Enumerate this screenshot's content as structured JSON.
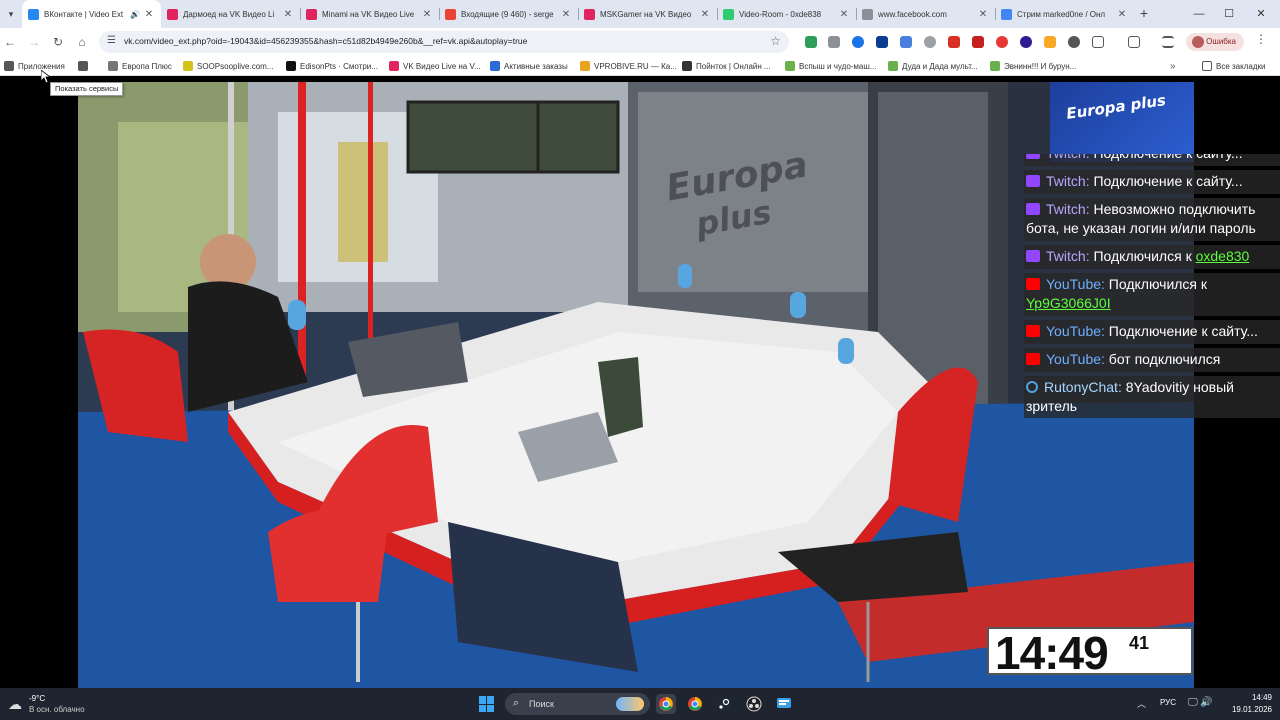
{
  "browser": {
    "tabs": [
      {
        "title": "ВКонтакте | Video Ext",
        "favicon": "vk-icon",
        "color": "#2787f5",
        "active": true,
        "audio": true
      },
      {
        "title": "Дармоед на VK Видео Li",
        "favicon": "vk-video-icon",
        "color": "#e0245e"
      },
      {
        "title": "Minami на VK Видео Live",
        "favicon": "vk-video-icon",
        "color": "#e0245e"
      },
      {
        "title": "Входящие (9 460) - serge",
        "favicon": "gmail-icon",
        "color": "#ea4335"
      },
      {
        "title": "MSKGamer на VK Видео",
        "favicon": "vk-video-icon",
        "color": "#e0245e"
      },
      {
        "title": "Video-Room - 0xde838",
        "favicon": "video-room-icon",
        "color": "#2ecc71"
      },
      {
        "title": "www.facebook.com",
        "favicon": "globe-icon",
        "color": "#8a8f98"
      },
      {
        "title": "Стрим marked0ne / Онл",
        "favicon": "google-icon",
        "color": "#4285f4"
      }
    ],
    "url": "vk.com/video_ext.php?oid=-19043&id=456239355&hash=c51d82b4949e260b&__ref=vk.api&autoplay=true",
    "error_label": "Ошибка",
    "bookmarks": [
      {
        "label": "Приложения",
        "color": "#555"
      },
      {
        "label": "",
        "color": "#555"
      },
      {
        "label": "Европа Плюс",
        "color": "#777"
      },
      {
        "label": "SOOPsooplive.com...",
        "color": "#d4c21c"
      },
      {
        "label": "EdisonPts · Смотри...",
        "color": "#111"
      },
      {
        "label": "VK Видео Live на V...",
        "color": "#e0245e"
      },
      {
        "label": "Активные заказы",
        "color": "#2a6bd8"
      },
      {
        "label": "VPROBIVE.RU — Ка...",
        "color": "#e8a320"
      },
      {
        "label": "Пойнток | Онлайн ...",
        "color": "#333"
      },
      {
        "label": "Вспыш и чудо-маш...",
        "color": "#6ab04c"
      },
      {
        "label": "Дуда и Дада мульт...",
        "color": "#6ab04c"
      },
      {
        "label": "Эвнинн!!! И бурун...",
        "color": "#6ab04c"
      }
    ],
    "all_bookmarks": "Все закладки",
    "tooltip": "Показать сервисы"
  },
  "video": {
    "chat": [
      {
        "source": "Twitch",
        "type": "twitch",
        "text": "Подключение к сайту...",
        "link": ""
      },
      {
        "source": "Twitch",
        "type": "twitch",
        "text": "Подключение к сайту...",
        "link": ""
      },
      {
        "source": "Twitch",
        "type": "twitch",
        "text": "Невозможно подключить бота, не указан логин и/или пароль",
        "link": ""
      },
      {
        "source": "Twitch",
        "type": "twitch",
        "text": "Подключился к ",
        "link": "oxde830"
      },
      {
        "source": "YouTube",
        "type": "youtube",
        "text": "Подключился к ",
        "link": "Yp9G3066J0I"
      },
      {
        "source": "YouTube",
        "type": "youtube",
        "text": "Подключение к сайту...",
        "link": ""
      },
      {
        "source": "YouTube",
        "type": "youtube",
        "text": "бот подключился",
        "link": ""
      },
      {
        "source": "RutonyChat",
        "type": "rutony",
        "text": "8Yadovitiy новый зритель",
        "link": ""
      }
    ],
    "clock": {
      "main": "14:49",
      "seconds": "41"
    },
    "logo": "Europa plus"
  },
  "taskbar": {
    "weather_temp": "-9°C",
    "weather_desc": "В осн. облачно",
    "search_label": "Поиск",
    "lang": "РУС",
    "time": "14:49",
    "date": "19.01.2026"
  }
}
